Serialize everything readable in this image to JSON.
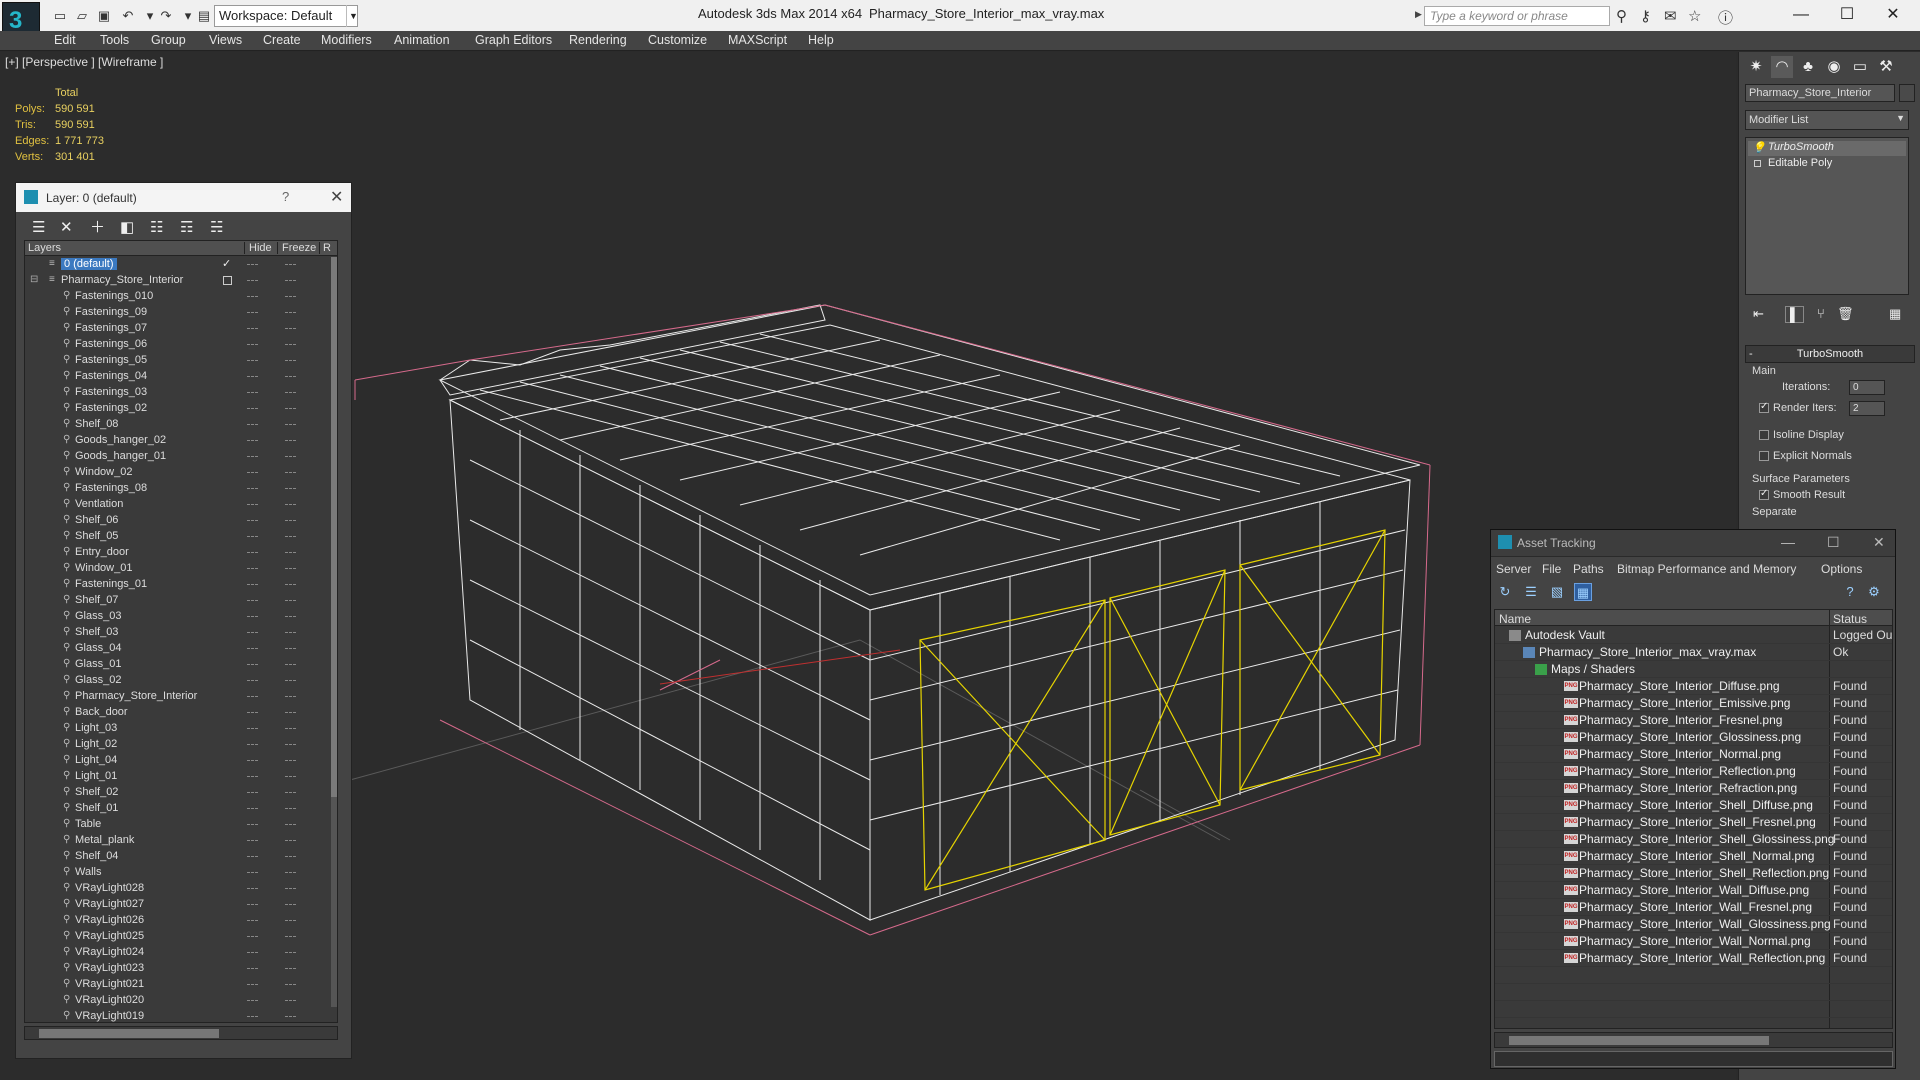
{
  "window": {
    "app_title": "Autodesk 3ds Max  2014 x64",
    "doc_title": "Pharmacy_Store_Interior_max_vray.max",
    "workspace": "Workspace: Default",
    "search_placeholder": "Type a keyword or phrase",
    "logo": "3"
  },
  "menu": [
    "Edit",
    "Tools",
    "Group",
    "Views",
    "Create",
    "Modifiers",
    "Animation",
    "Graph Editors",
    "Rendering",
    "Customize",
    "MAXScript",
    "Help"
  ],
  "viewport": {
    "label": "[+] [Perspective ] [Wireframe ]",
    "stats": {
      "header": "Total",
      "rows": [
        {
          "label": "Polys:",
          "value": "590 591"
        },
        {
          "label": "Tris:",
          "value": "590 591"
        },
        {
          "label": "Edges:",
          "value": "1 771 773"
        },
        {
          "label": "Verts:",
          "value": "301 401"
        }
      ]
    }
  },
  "layer_panel": {
    "title": "Layer: 0 (default)",
    "help": "?",
    "columns": {
      "layers": "Layers",
      "hide": "Hide",
      "freeze": "Freeze",
      "render": "R"
    },
    "default_layer": "0 (default)",
    "parent_layer": "Pharmacy_Store_Interior",
    "children": [
      "Fastenings_010",
      "Fastenings_09",
      "Fastenings_07",
      "Fastenings_06",
      "Fastenings_05",
      "Fastenings_04",
      "Fastenings_03",
      "Fastenings_02",
      "Shelf_08",
      "Goods_hanger_02",
      "Goods_hanger_01",
      "Window_02",
      "Fastenings_08",
      "Ventlation",
      "Shelf_06",
      "Shelf_05",
      "Entry_door",
      "Window_01",
      "Fastenings_01",
      "Shelf_07",
      "Glass_03",
      "Shelf_03",
      "Glass_04",
      "Glass_01",
      "Glass_02",
      "Pharmacy_Store_Interior",
      "Back_door",
      "Light_03",
      "Light_02",
      "Light_04",
      "Light_01",
      "Shelf_02",
      "Shelf_01",
      "Table",
      "Metal_plank",
      "Shelf_04",
      "Walls",
      "VRayLight028",
      "VRayLight027",
      "VRayLight026",
      "VRayLight025",
      "VRayLight024",
      "VRayLight023",
      "VRayLight021",
      "VRayLight020",
      "VRayLight019"
    ]
  },
  "command_panel": {
    "object_name": "Pharmacy_Store_Interior",
    "modifier_list": "Modifier List",
    "stack": [
      "TurboSmooth",
      "Editable Poly"
    ],
    "rollout": {
      "title": "TurboSmooth",
      "main": "Main",
      "iterations_label": "Iterations:",
      "iterations": "0",
      "render_iters_label": "Render Iters:",
      "render_iters": "2",
      "isoline": "Isoline Display",
      "explicit": "Explicit Normals",
      "surface": "Surface Parameters",
      "smooth": "Smooth Result",
      "separate": "Separate"
    }
  },
  "asset_panel": {
    "title": "Asset Tracking",
    "menu": [
      "Server",
      "File",
      "Paths",
      "Bitmap Performance and Memory",
      "Options"
    ],
    "columns": {
      "name": "Name",
      "status": "Status"
    },
    "rows": [
      {
        "name": "Autodesk Vault",
        "status": "Logged Out",
        "level": 0,
        "kind": "vault"
      },
      {
        "name": "Pharmacy_Store_Interior_max_vray.max",
        "status": "Ok",
        "level": 1,
        "kind": "max"
      },
      {
        "name": "Maps / Shaders",
        "status": "",
        "level": 2,
        "kind": "folder"
      },
      {
        "name": "Pharmacy_Store_Interior_Diffuse.png",
        "status": "Found",
        "level": 3,
        "kind": "png"
      },
      {
        "name": "Pharmacy_Store_Interior_Emissive.png",
        "status": "Found",
        "level": 3,
        "kind": "png"
      },
      {
        "name": "Pharmacy_Store_Interior_Fresnel.png",
        "status": "Found",
        "level": 3,
        "kind": "png"
      },
      {
        "name": "Pharmacy_Store_Interior_Glossiness.png",
        "status": "Found",
        "level": 3,
        "kind": "png"
      },
      {
        "name": "Pharmacy_Store_Interior_Normal.png",
        "status": "Found",
        "level": 3,
        "kind": "png"
      },
      {
        "name": "Pharmacy_Store_Interior_Reflection.png",
        "status": "Found",
        "level": 3,
        "kind": "png"
      },
      {
        "name": "Pharmacy_Store_Interior_Refraction.png",
        "status": "Found",
        "level": 3,
        "kind": "png"
      },
      {
        "name": "Pharmacy_Store_Interior_Shell_Diffuse.png",
        "status": "Found",
        "level": 3,
        "kind": "png"
      },
      {
        "name": "Pharmacy_Store_Interior_Shell_Fresnel.png",
        "status": "Found",
        "level": 3,
        "kind": "png"
      },
      {
        "name": "Pharmacy_Store_Interior_Shell_Glossiness.png",
        "status": "Found",
        "level": 3,
        "kind": "png"
      },
      {
        "name": "Pharmacy_Store_Interior_Shell_Normal.png",
        "status": "Found",
        "level": 3,
        "kind": "png"
      },
      {
        "name": "Pharmacy_Store_Interior_Shell_Reflection.png",
        "status": "Found",
        "level": 3,
        "kind": "png"
      },
      {
        "name": "Pharmacy_Store_Interior_Wall_Diffuse.png",
        "status": "Found",
        "level": 3,
        "kind": "png"
      },
      {
        "name": "Pharmacy_Store_Interior_Wall_Fresnel.png",
        "status": "Found",
        "level": 3,
        "kind": "png"
      },
      {
        "name": "Pharmacy_Store_Interior_Wall_Glossiness.png",
        "status": "Found",
        "level": 3,
        "kind": "png"
      },
      {
        "name": "Pharmacy_Store_Interior_Wall_Normal.png",
        "status": "Found",
        "level": 3,
        "kind": "png"
      },
      {
        "name": "Pharmacy_Store_Interior_Wall_Reflection.png",
        "status": "Found",
        "level": 3,
        "kind": "png"
      }
    ]
  },
  "colors": {
    "selection": "#3b79c0",
    "stats_text": "#e8d060",
    "wire_white": "#ffffff",
    "wire_yellow": "#e6d400",
    "wire_pink": "#d66a8c",
    "png_icon": "#c02020"
  }
}
